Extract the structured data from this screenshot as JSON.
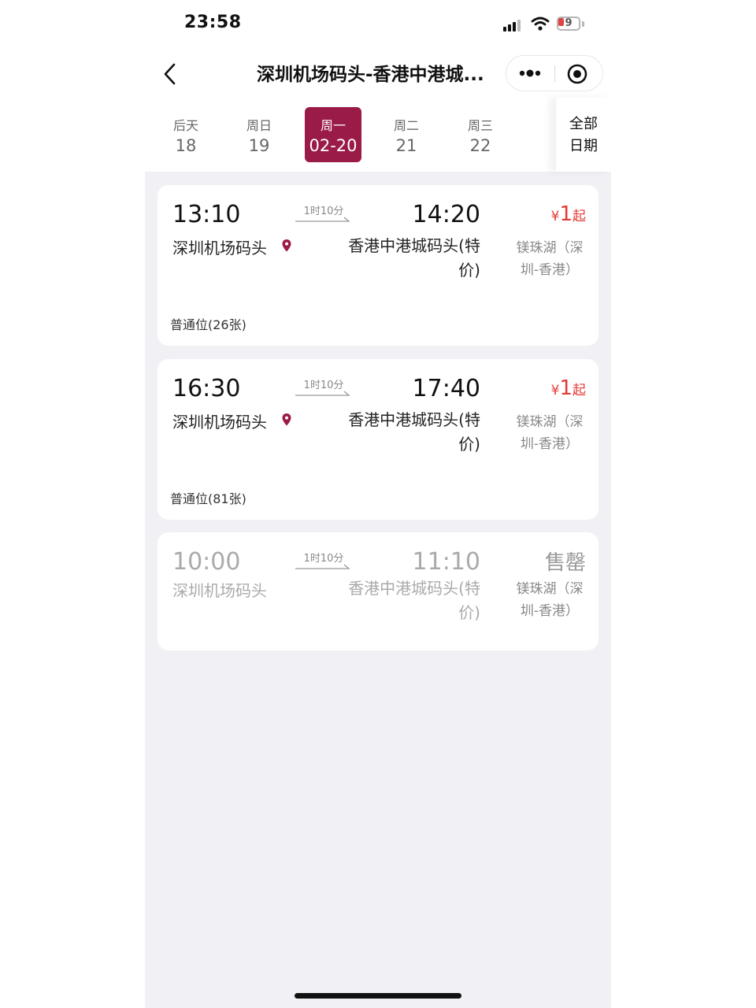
{
  "status_bar": {
    "time": "23:58",
    "battery": "9"
  },
  "header": {
    "title": "深圳机场码头-香港中港城..."
  },
  "date_tabs": [
    {
      "weekday": "后天",
      "date": "18",
      "active": false
    },
    {
      "weekday": "周日",
      "date": "19",
      "active": false
    },
    {
      "weekday": "周一",
      "date": "02-20",
      "active": true
    },
    {
      "weekday": "周二",
      "date": "21",
      "active": false
    },
    {
      "weekday": "周三",
      "date": "22",
      "active": false
    }
  ],
  "all_dates": {
    "line1": "全部",
    "line2": "日期"
  },
  "trips": [
    {
      "depart_time": "13:10",
      "duration": "1时10分",
      "arrive_time": "14:20",
      "depart_port": "深圳机场码头",
      "arrive_port": "香港中港城码头(特价)",
      "price_symbol": "¥",
      "price": "1",
      "price_suffix": "起",
      "route": "镁珠湖（深圳-香港）",
      "seat": "普通位(26张)",
      "sold_out": false
    },
    {
      "depart_time": "16:30",
      "duration": "1时10分",
      "arrive_time": "17:40",
      "depart_port": "深圳机场码头",
      "arrive_port": "香港中港城码头(特价)",
      "price_symbol": "¥",
      "price": "1",
      "price_suffix": "起",
      "route": "镁珠湖（深圳-香港）",
      "seat": "普通位(81张)",
      "sold_out": false
    },
    {
      "depart_time": "10:00",
      "duration": "1时10分",
      "arrive_time": "11:10",
      "depart_port": "深圳机场码头",
      "arrive_port": "香港中港城码头(特价)",
      "status": "售罄",
      "route": "镁珠湖（深圳-香港）",
      "sold_out": true
    }
  ],
  "colors": {
    "accent": "#9a1b48",
    "price": "#e53935",
    "background": "#f1f1f5"
  },
  "icons": [
    "back-icon",
    "more-icon",
    "close-mini-program-icon",
    "location-pin-icon",
    "signal-icon",
    "wifi-icon",
    "battery-icon"
  ]
}
